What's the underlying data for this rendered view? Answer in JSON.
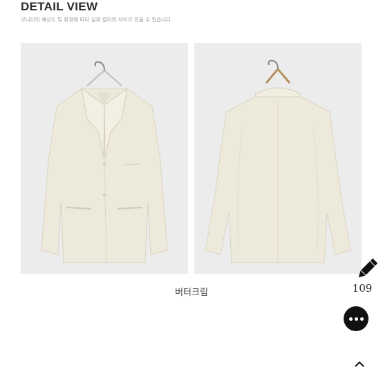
{
  "header": {
    "title": "DETAIL VIEW",
    "subtitle": "모니터의 해상도 및 환경에 따라 실제 컬러와 차이가 있을 수 있습니다."
  },
  "gallery": {
    "images": [
      {
        "view": "front",
        "alt": "jacket-front"
      },
      {
        "view": "back",
        "alt": "jacket-back"
      }
    ],
    "caption": "버터크림"
  },
  "float_tools": {
    "edit_icon": "pencil-icon",
    "count": "109",
    "chat_icon": "chat-bubble-icon",
    "scroll_top_icon": "chevron-up-icon"
  },
  "colors": {
    "background": "#ffffff",
    "photo_bg": "#ececec",
    "jacket": "#eeeadb",
    "icon": "#111111"
  }
}
